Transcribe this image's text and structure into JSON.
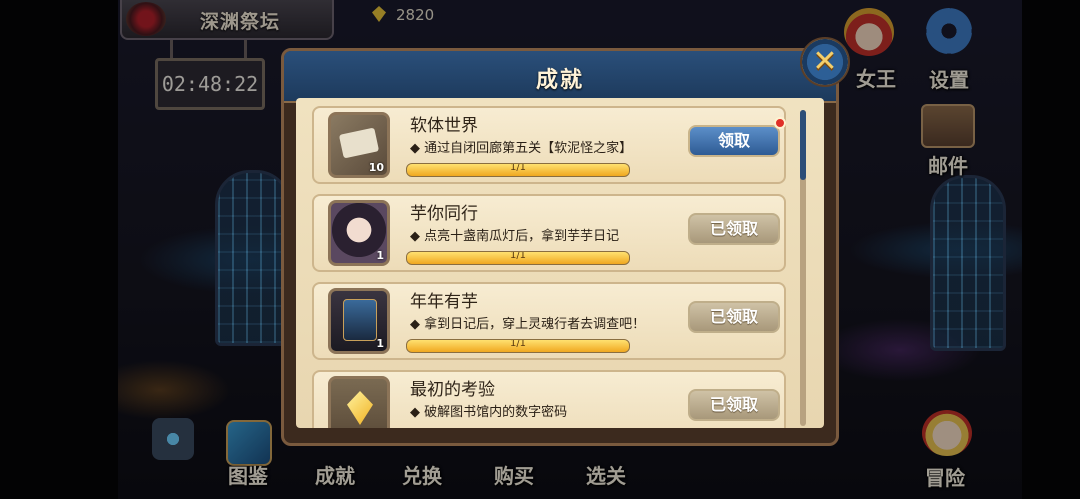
{
  "location": "深渊祭坛",
  "currency": {
    "icon": "gem-icon",
    "amount": "2820"
  },
  "timer": "02:48:22",
  "side_menu": {
    "queen_label": "女王",
    "settings_label": "设置",
    "mail_label": "邮件"
  },
  "bottom_nav": {
    "atlas_label": "图鉴",
    "achievement_label": "成就",
    "exchange_label": "兑换",
    "buy_label": "购买",
    "stage_label": "选关",
    "adventure_label": "冒险"
  },
  "dialog": {
    "title": "成就",
    "close_icon": "close-icon",
    "achievements": [
      {
        "title": "软体世界",
        "desc": "◆ 通过自闭回廊第五关【软泥怪之家】",
        "count": "10",
        "progress": "1/1",
        "progress_fraction": 1.0,
        "button": "领取",
        "claimed": false
      },
      {
        "title": "芋你同行",
        "desc": "◆ 点亮十盏南瓜灯后，拿到芋芋日记",
        "count": "1",
        "progress": "1/1",
        "progress_fraction": 1.0,
        "button": "已领取",
        "claimed": true
      },
      {
        "title": "年年有芋",
        "desc": "◆ 拿到日记后，穿上灵魂行者去调查吧！",
        "count": "1",
        "progress": "1/1",
        "progress_fraction": 1.0,
        "button": "已领取",
        "claimed": true
      },
      {
        "title": "最初的考验",
        "desc": "◆ 破解图书馆内的数字密码",
        "count": "",
        "progress": "",
        "progress_fraction": 1.0,
        "button": "已领取",
        "claimed": true
      }
    ]
  },
  "colors": {
    "accent_blue": "#2e5b94",
    "gold": "#f0a820",
    "parchment": "#f0e2c0"
  }
}
